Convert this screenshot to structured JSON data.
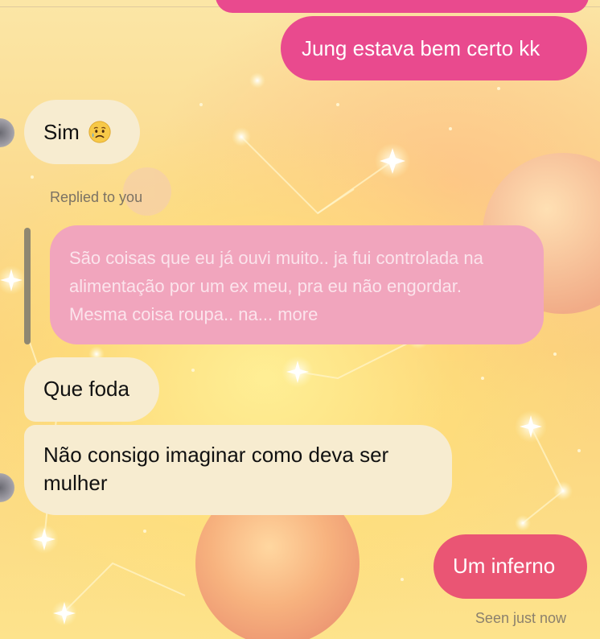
{
  "messages": {
    "out_1": "Jung estava bem certo kk",
    "in_1": "Sim",
    "in_1_emoji": "sad-but-relieved-face-icon",
    "reply_label": "Replied to you",
    "reply_quote": "São coisas que eu já ouvi muito.. ja fui controlada na alimentação por um ex meu, pra eu não engordar. Mesma coisa roupa.. na... more",
    "in_2": "Que foda",
    "in_3": "Não consigo imaginar como deva ser mulher",
    "out_2": "Um inferno",
    "seen_status": "Seen just now"
  },
  "colors": {
    "outgoing_bubble": "#e94a8e",
    "outgoing_bubble_last": "#ea5574",
    "incoming_bubble": "#f7ecd0",
    "reply_bubble": "#f1a5bd"
  }
}
